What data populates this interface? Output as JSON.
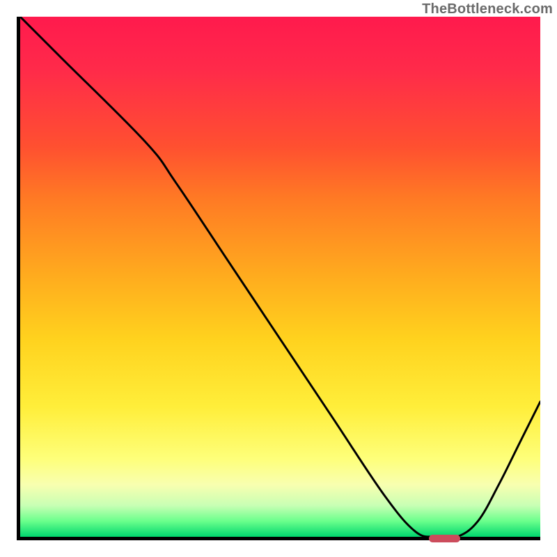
{
  "watermark": "TheBottleneck.com",
  "chart_data": {
    "type": "line",
    "title": "",
    "xlabel": "",
    "ylabel": "",
    "xlim": [
      0,
      100
    ],
    "ylim": [
      0,
      100
    ],
    "grid": false,
    "legend": false,
    "series": [
      {
        "name": "curve",
        "x": [
          0,
          8,
          24,
          30,
          40,
          50,
          60,
          70,
          76,
          80,
          84,
          88,
          92,
          96,
          100
        ],
        "values": [
          100,
          92,
          76,
          68,
          53,
          38,
          23,
          8,
          1,
          0,
          0,
          3,
          10,
          18,
          26
        ]
      }
    ],
    "marker": {
      "x_start": 78,
      "x_end": 84,
      "y": 0,
      "color": "#cc4c5c"
    },
    "colors": {
      "gradient_top": "#ff1a4d",
      "gradient_bottom": "#00d66e",
      "axis": "#000000",
      "curve": "#000000"
    }
  }
}
